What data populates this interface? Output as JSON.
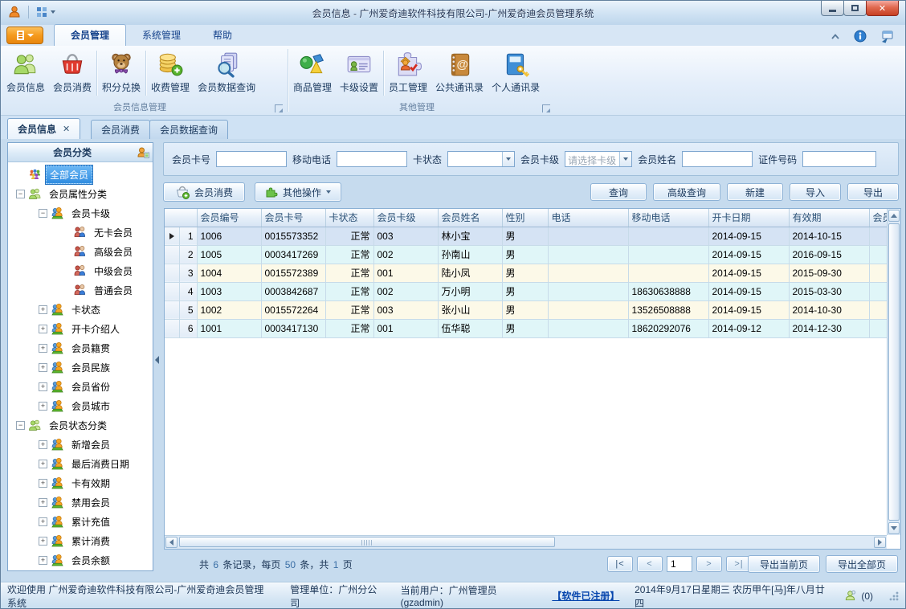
{
  "window": {
    "title": "会员信息 - 广州爱奇迪软件科技有限公司-广州爱奇迪会员管理系统"
  },
  "colors": {
    "app_menu_orange": "#f59a1d",
    "close_button_red": "#c63f22",
    "tree_selection_blue": "#2f8ce0",
    "row_alt_cyan": "#e0f6f8",
    "row_alt_cream": "#fcf9e8",
    "focused_row_blue": "#d5e3f4",
    "link_blue": "#0645ad"
  },
  "ribbon": {
    "tabs": [
      {
        "label": "会员管理",
        "active": true
      },
      {
        "label": "系统管理",
        "active": false
      },
      {
        "label": "帮助",
        "active": false
      }
    ],
    "groups": [
      {
        "label": "会员信息管理",
        "buttons": [
          {
            "label": "会员信息"
          },
          {
            "label": "会员消费"
          },
          {
            "label": "积分兑换"
          },
          {
            "label": "收费管理"
          },
          {
            "label": "会员数据查询"
          }
        ]
      },
      {
        "label": "其他管理",
        "buttons": [
          {
            "label": "商品管理"
          },
          {
            "label": "卡级设置"
          },
          {
            "label": "员工管理"
          },
          {
            "label": "公共通讯录"
          },
          {
            "label": "个人通讯录"
          }
        ]
      }
    ]
  },
  "doc_tabs": [
    {
      "label": "会员信息",
      "active": true,
      "closable": true
    },
    {
      "label": "会员消费",
      "active": false
    },
    {
      "label": "会员数据查询",
      "active": false
    }
  ],
  "sidebar": {
    "header": "会员分类",
    "tree": [
      {
        "label": "全部会员",
        "level": 0,
        "icon": "all",
        "expander": null,
        "selected": true
      },
      {
        "label": "会员属性分类",
        "level": 0,
        "icon": "green",
        "expander": "minus",
        "selected": false
      },
      {
        "label": "会员卡级",
        "level": 1,
        "icon": "orange",
        "expander": "minus",
        "selected": false
      },
      {
        "label": "无卡会员",
        "level": 2,
        "icon": "pair",
        "expander": null,
        "selected": false
      },
      {
        "label": "高级会员",
        "level": 2,
        "icon": "pair",
        "expander": null,
        "selected": false
      },
      {
        "label": "中级会员",
        "level": 2,
        "icon": "pair",
        "expander": null,
        "selected": false
      },
      {
        "label": "普通会员",
        "level": 2,
        "icon": "pair",
        "expander": null,
        "selected": false
      },
      {
        "label": "卡状态",
        "level": 1,
        "icon": "orange",
        "expander": "plus",
        "selected": false
      },
      {
        "label": "开卡介绍人",
        "level": 1,
        "icon": "orange",
        "expander": "plus",
        "selected": false
      },
      {
        "label": "会员籍贯",
        "level": 1,
        "icon": "orange",
        "expander": "plus",
        "selected": false
      },
      {
        "label": "会员民族",
        "level": 1,
        "icon": "orange",
        "expander": "plus",
        "selected": false
      },
      {
        "label": "会员省份",
        "level": 1,
        "icon": "orange",
        "expander": "plus",
        "selected": false
      },
      {
        "label": "会员城市",
        "level": 1,
        "icon": "orange",
        "expander": "plus",
        "selected": false
      },
      {
        "label": "会员状态分类",
        "level": 0,
        "icon": "green",
        "expander": "minus",
        "selected": false
      },
      {
        "label": "新增会员",
        "level": 1,
        "icon": "orange",
        "expander": "plus",
        "selected": false
      },
      {
        "label": "最后消费日期",
        "level": 1,
        "icon": "orange",
        "expander": "plus",
        "selected": false
      },
      {
        "label": "卡有效期",
        "level": 1,
        "icon": "orange",
        "expander": "plus",
        "selected": false
      },
      {
        "label": "禁用会员",
        "level": 1,
        "icon": "orange",
        "expander": "plus",
        "selected": false
      },
      {
        "label": "累计充值",
        "level": 1,
        "icon": "orange",
        "expander": "plus",
        "selected": false
      },
      {
        "label": "累计消费",
        "level": 1,
        "icon": "orange",
        "expander": "plus",
        "selected": false
      },
      {
        "label": "会员余额",
        "level": 1,
        "icon": "orange",
        "expander": "plus",
        "selected": false
      }
    ]
  },
  "filters": {
    "card_no": {
      "label": "会员卡号",
      "value": ""
    },
    "mobile": {
      "label": "移动电话",
      "value": ""
    },
    "card_state": {
      "label": "卡状态",
      "value": ""
    },
    "card_level": {
      "label": "会员卡级",
      "value": "请选择卡级"
    },
    "name": {
      "label": "会员姓名",
      "value": ""
    },
    "id_no": {
      "label": "证件号码",
      "value": ""
    }
  },
  "toolbar": {
    "consume_label": "会员消费",
    "other_ops_label": "其他操作",
    "query_label": "查询",
    "adv_query_label": "高级查询",
    "new_label": "新建",
    "import_label": "导入",
    "export_label": "导出"
  },
  "grid": {
    "columns": [
      "会员编号",
      "会员卡号",
      "卡状态",
      "会员卡级",
      "会员姓名",
      "性别",
      "电话",
      "移动电话",
      "开卡日期",
      "有效期",
      "会员"
    ],
    "rows": [
      [
        "1006",
        "0015573352",
        "正常",
        "003",
        "林小宝",
        "男",
        "",
        "",
        "2014-09-15",
        "2014-10-15",
        ""
      ],
      [
        "1005",
        "0003417269",
        "正常",
        "002",
        "孙南山",
        "男",
        "",
        "",
        "2014-09-15",
        "2016-09-15",
        ""
      ],
      [
        "1004",
        "0015572389",
        "正常",
        "001",
        "陆小凤",
        "男",
        "",
        "",
        "2014-09-15",
        "2015-09-30",
        ""
      ],
      [
        "1003",
        "0003842687",
        "正常",
        "002",
        "万小明",
        "男",
        "",
        "18630638888",
        "2014-09-15",
        "2015-03-30",
        ""
      ],
      [
        "1002",
        "0015572264",
        "正常",
        "003",
        "张小山",
        "男",
        "",
        "13526508888",
        "2014-09-15",
        "2014-10-30",
        ""
      ],
      [
        "1001",
        "0003417130",
        "正常",
        "001",
        "伍华聪",
        "男",
        "",
        "18620292076",
        "2014-09-12",
        "2014-12-30",
        ""
      ]
    ],
    "selected_row_index": 0
  },
  "pagination": {
    "summary": {
      "label_total": "共",
      "records": "6",
      "label_records": "条记录，每页",
      "page_size": "50",
      "label_pages": "条，共",
      "pages": "1",
      "label_page_unit": "页"
    },
    "first": "|<",
    "prev": "<",
    "page_value": "1",
    "next": ">",
    "last": ">|",
    "export_page_label": "导出当前页",
    "export_all_label": "导出全部页"
  },
  "statusbar": {
    "welcome": "欢迎使用 广州爱奇迪软件科技有限公司-广州爱奇迪会员管理系统",
    "unit": "管理单位：广州分公司",
    "user": "当前用户：广州管理员(gzadmin)",
    "license": "【软件已注册】",
    "datetime": "2014年9月17日星期三 农历甲午[马]年八月廿四",
    "message_count": "(0)"
  }
}
